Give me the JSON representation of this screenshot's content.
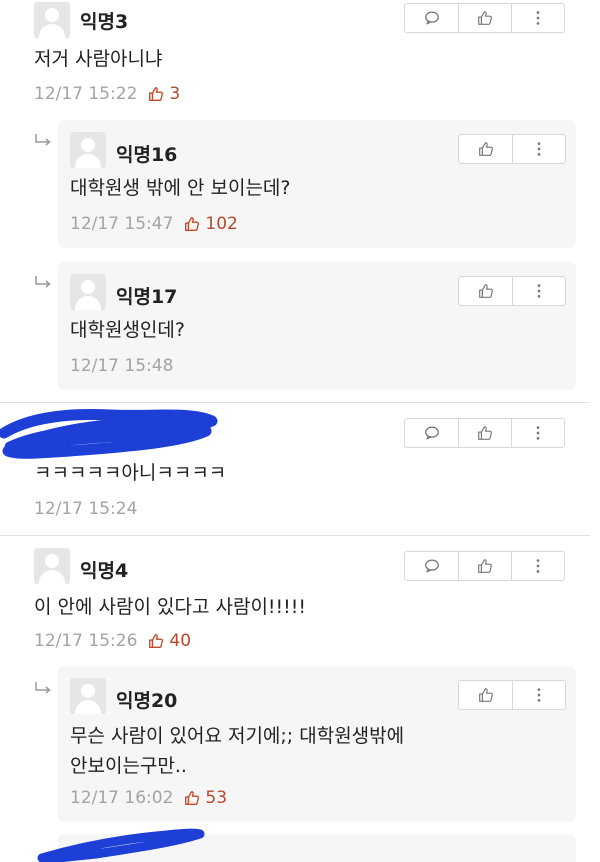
{
  "comments": [
    {
      "nick": "익명3",
      "text": "저거 사람아니냐",
      "time": "12/17 15:22",
      "likes": "3"
    },
    {
      "nick": "익명16",
      "text": "대학원생 밖에 안 보이는데?",
      "time": "12/17 15:47",
      "likes": "102"
    },
    {
      "nick": "익명17",
      "text": "대학원생인데?",
      "time": "12/17 15:48"
    },
    {
      "nick": "",
      "text": "ㅋㅋㅋㅋㅋ아니ㅋㅋㅋㅋ",
      "time": "12/17 15:24"
    },
    {
      "nick": "익명4",
      "text": "이 안에 사람이 있다고 사람이!!!!!",
      "time": "12/17 15:26",
      "likes": "40"
    },
    {
      "nick": "익명20",
      "text_line1": "무슨 사람이 있어요 저기에;; 대학원생밖에",
      "text_line2": "안보이는구만..",
      "time": "12/17 16:02",
      "likes": "53"
    }
  ],
  "icons": {
    "reply": "speech-bubble-icon",
    "like": "thumbs-up-icon",
    "more": "vertical-dots-icon"
  },
  "colors": {
    "like_count": "#b44a2c",
    "scribble": "#1d3fd6"
  }
}
